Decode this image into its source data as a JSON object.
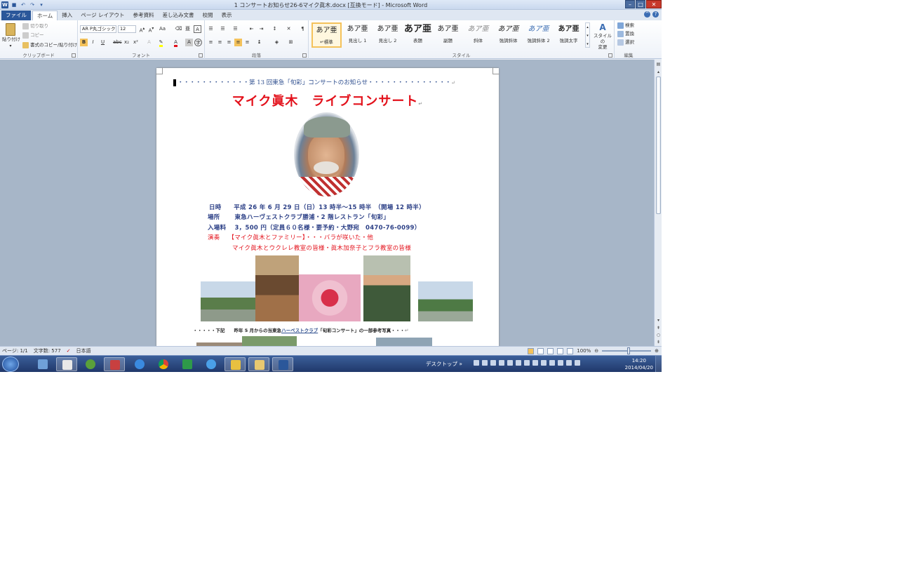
{
  "window": {
    "title": "1 コンサートお知らせ26-6マイク眞木.docx [互換モード] - Microsoft Word"
  },
  "tabs": [
    "ファイル",
    "ホーム",
    "挿入",
    "ページ レイアウト",
    "参考資料",
    "差し込み文書",
    "校閲",
    "表示"
  ],
  "clipboard": {
    "paste": "貼り付け",
    "cut": "切り取り",
    "copy": "コピー",
    "format_painter": "書式のコピー/貼り付け",
    "label": "クリップボード"
  },
  "font": {
    "name": "AR P丸ゴシック",
    "size": "12",
    "label": "フォント"
  },
  "paragraph": {
    "label": "段落"
  },
  "styles": {
    "label": "スタイル",
    "items": [
      {
        "preview": "あア亜",
        "name": "↵標準"
      },
      {
        "preview": "あア亜",
        "name": "見出し 1"
      },
      {
        "preview": "あア亜",
        "name": "見出し 2"
      },
      {
        "preview": "あア亜",
        "name": "表題"
      },
      {
        "preview": "あア亜",
        "name": "副題"
      },
      {
        "preview": "あア亜",
        "name": "斜体"
      },
      {
        "preview": "あア亜",
        "name": "強調斜体"
      },
      {
        "preview": "あア亜",
        "name": "強調斜体 2"
      },
      {
        "preview": "あア亜",
        "name": "強調太字"
      }
    ],
    "change": "スタイルの\n変更"
  },
  "editing": {
    "label": "編集",
    "find": "検索",
    "replace": "置換",
    "select": "選択"
  },
  "document": {
    "header_line": "・・・・・・・・・・・・第 13 回東急「旬彩」コンサートのお知らせ・・・・・・・・・・・・・・",
    "main_title": "マイク眞木　ライブコンサート",
    "date": "日時　　平成 26 年 6 月 29 日（日）13 時半～15 時半　（開場 12 時半）",
    "place": "場所　　 東急ハーヴェストクラブ勝浦・2 階レストラン「旬彩」",
    "fee": "入場料　 3，500 円（定員６０名様・要予約・大野宛　0470-76-0099）",
    "performance": "演奏　 【マイク眞木とファミリー】・・・バラが咲いた・他",
    "performance2": "マイク眞木とウクレレ教室の皆様・眞木加奈子とフラ教室の皆様",
    "footnote_pre": "・・・・・下記　　昨年 5 月からの当東急",
    "footnote_link": "ハーベストクラブ",
    "footnote_post": "「旬彩コンサート」の一部参考写真・・・"
  },
  "status": {
    "page": "ページ: 1/1",
    "words": "文字数: 577",
    "lang": "日本語",
    "zoom": "100%"
  },
  "taskbar": {
    "desktop": "デスクトップ",
    "time": "14:20",
    "date": "2014/04/20"
  },
  "colors": {
    "accent": "#2b579a",
    "title_red": "#e3111b",
    "info_blue": "#2b3f86"
  }
}
